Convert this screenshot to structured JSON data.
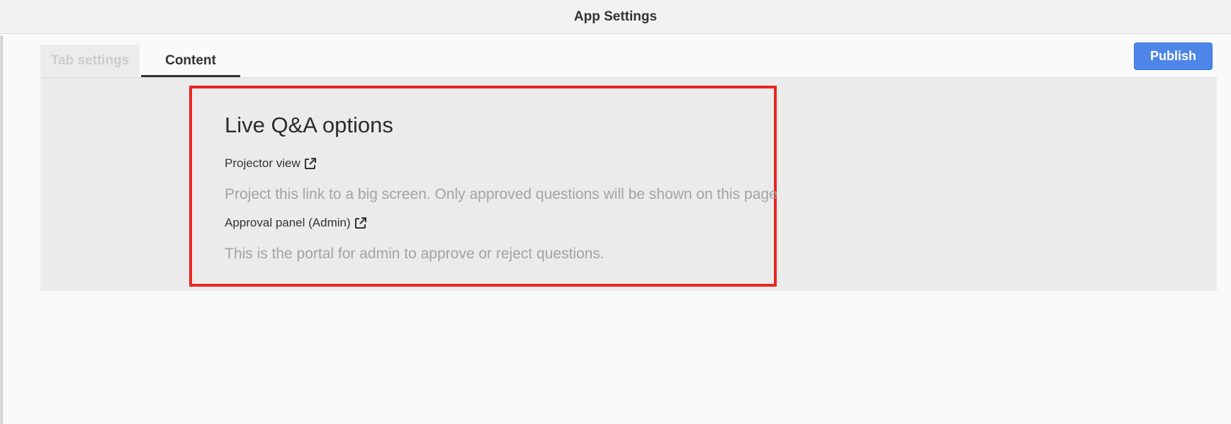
{
  "window": {
    "title": "App Settings"
  },
  "tabs": [
    {
      "label": "Tab settings",
      "active": false
    },
    {
      "label": "Content",
      "active": true
    }
  ],
  "toolbar": {
    "publish_label": "Publish",
    "accent_color": "#4d86e8"
  },
  "content": {
    "section_title": "Live Q&A options",
    "links": [
      {
        "label": "Projector view",
        "icon": "external-link-icon",
        "description": "Project this link to a big screen. Only approved questions will be shown on this page"
      },
      {
        "label": "Approval panel (Admin)",
        "icon": "external-link-icon",
        "description": "This is the portal for admin to approve or reject questions."
      }
    ],
    "highlight_color": "#e8261f"
  }
}
